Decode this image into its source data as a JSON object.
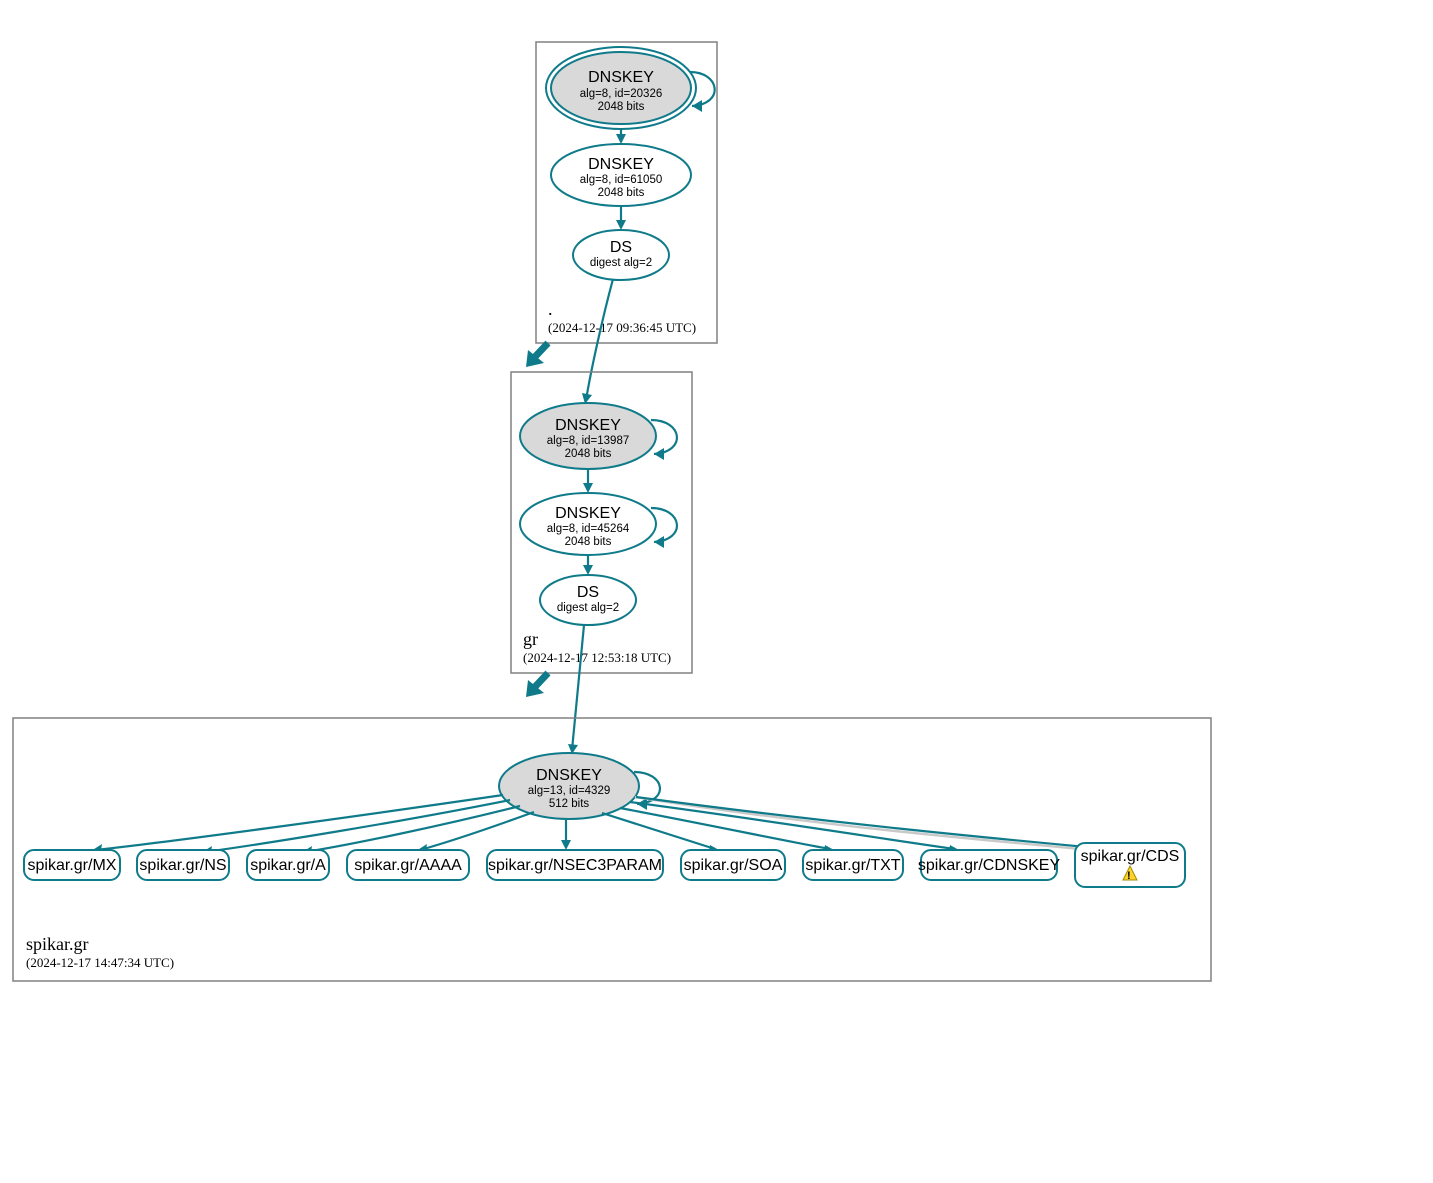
{
  "zones": {
    "root": {
      "name": ".",
      "timestamp": "(2024-12-17 09:36:45 UTC)"
    },
    "tld": {
      "name": "gr",
      "timestamp": "(2024-12-17 12:53:18 UTC)"
    },
    "leaf": {
      "name": "spikar.gr",
      "timestamp": "(2024-12-17 14:47:34 UTC)"
    }
  },
  "nodes": {
    "root_ksk": {
      "title": "DNSKEY",
      "line1": "alg=8, id=20326",
      "line2": "2048 bits"
    },
    "root_zsk": {
      "title": "DNSKEY",
      "line1": "alg=8, id=61050",
      "line2": "2048 bits"
    },
    "root_ds": {
      "title": "DS",
      "line1": "digest alg=2"
    },
    "tld_ksk": {
      "title": "DNSKEY",
      "line1": "alg=8, id=13987",
      "line2": "2048 bits"
    },
    "tld_zsk": {
      "title": "DNSKEY",
      "line1": "alg=8, id=45264",
      "line2": "2048 bits"
    },
    "tld_ds": {
      "title": "DS",
      "line1": "digest alg=2"
    },
    "leaf_key": {
      "title": "DNSKEY",
      "line1": "alg=13, id=4329",
      "line2": "512 bits"
    }
  },
  "rrsets": {
    "mx": "spikar.gr/MX",
    "ns": "spikar.gr/NS",
    "a": "spikar.gr/A",
    "aaaa": "spikar.gr/AAAA",
    "nsec3param": "spikar.gr/NSEC3PARAM",
    "soa": "spikar.gr/SOA",
    "txt": "spikar.gr/TXT",
    "cdnskey": "spikar.gr/CDNSKEY",
    "cds": "spikar.gr/CDS"
  }
}
